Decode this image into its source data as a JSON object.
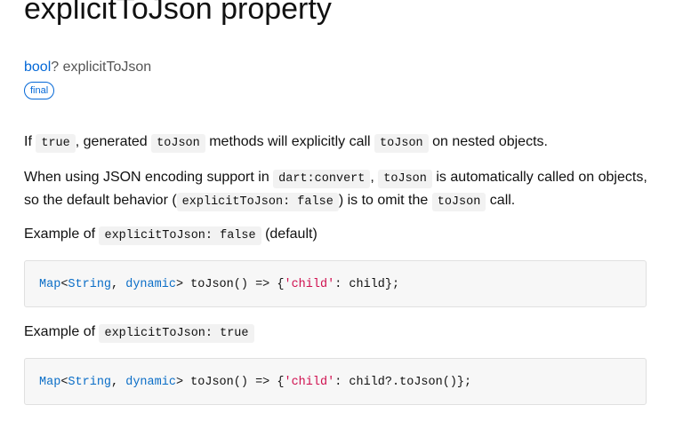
{
  "title": "explicitToJson property",
  "signature": {
    "type": "bool",
    "suffix": "? explicitToJson"
  },
  "badge": "final",
  "para1": {
    "t1": "If ",
    "c1": "true",
    "t2": ", generated ",
    "c2": "toJson",
    "t3": " methods will explicitly call ",
    "c3": "toJson",
    "t4": " on nested objects."
  },
  "para2": {
    "t1": "When using JSON encoding support in ",
    "c1": "dart:convert",
    "t2": ", ",
    "c2": "toJson",
    "t3": " is automatically called on objects, so the default behavior (",
    "c3": "explicitToJson: false",
    "t4": ") is to omit the ",
    "c4": "toJson",
    "t5": " call."
  },
  "example1": {
    "prefix": "Example of ",
    "code": "explicitToJson: false",
    "suffix": " (default)"
  },
  "code1": {
    "map": "Map",
    "lt": "<",
    "string": "String",
    "comma": ", ",
    "dynamic": "dynamic",
    "rest": "> toJson() => {",
    "key": "'child'",
    "tail": ": child};"
  },
  "example2": {
    "prefix": "Example of ",
    "code": "explicitToJson: true"
  },
  "code2": {
    "map": "Map",
    "lt": "<",
    "string": "String",
    "comma": ", ",
    "dynamic": "dynamic",
    "rest": "> toJson() => {",
    "key": "'child'",
    "tail": ": child?.toJson()};"
  }
}
